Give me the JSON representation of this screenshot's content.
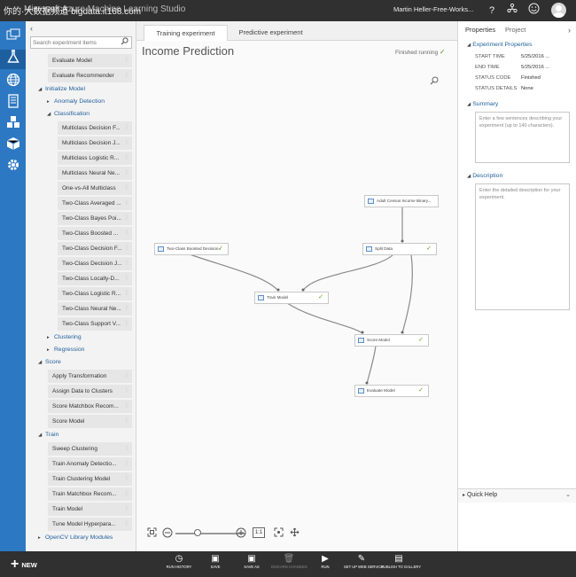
{
  "titlebar": {
    "watermark": "你的·大数据频道 bigdata.it168.com",
    "title": "Microsoft Azure Machine Learning Studio",
    "user": "Martin Heller-Free-Works...",
    "help_glyph": "?"
  },
  "rail": {
    "icons": [
      "projects-icon",
      "experiments-icon",
      "web-services-icon",
      "notebooks-icon",
      "datasets-icon",
      "trained-models-icon",
      "settings-icon"
    ]
  },
  "palette": {
    "collapse_glyph": "‹",
    "search_placeholder": "Search experiment items",
    "items": [
      {
        "kind": "mod",
        "label": "Evaluate Model"
      },
      {
        "kind": "mod",
        "label": "Evaluate Recommender"
      },
      {
        "kind": "cat",
        "label": "Initialize Model",
        "open": true
      },
      {
        "kind": "subcat",
        "label": "Anomaly Detection",
        "open": false
      },
      {
        "kind": "subcat",
        "label": "Classification",
        "open": true
      },
      {
        "kind": "mod2",
        "label": "Multiclass Decision F..."
      },
      {
        "kind": "mod2",
        "label": "Multiclass Decision J..."
      },
      {
        "kind": "mod2",
        "label": "Multiclass Logistic R..."
      },
      {
        "kind": "mod2",
        "label": "Multiclass Neural Ne..."
      },
      {
        "kind": "mod2",
        "label": "One-vs-All Multiclass"
      },
      {
        "kind": "mod2",
        "label": "Two-Class Averaged ..."
      },
      {
        "kind": "mod2",
        "label": "Two-Class Bayes Poi..."
      },
      {
        "kind": "mod2",
        "label": "Two-Class Boosted ..."
      },
      {
        "kind": "mod2",
        "label": "Two-Class Decision F..."
      },
      {
        "kind": "mod2",
        "label": "Two-Class Decision J..."
      },
      {
        "kind": "mod2",
        "label": "Two-Class Locally-D..."
      },
      {
        "kind": "mod2",
        "label": "Two-Class Logistic R..."
      },
      {
        "kind": "mod2",
        "label": "Two-Class Neural Ne..."
      },
      {
        "kind": "mod2",
        "label": "Two-Class Support V..."
      },
      {
        "kind": "subcat",
        "label": "Clustering",
        "open": false
      },
      {
        "kind": "subcat",
        "label": "Regression",
        "open": false
      },
      {
        "kind": "cat",
        "label": "Score",
        "open": true
      },
      {
        "kind": "mod",
        "label": "Apply Transformation"
      },
      {
        "kind": "mod",
        "label": "Assign Data to Clusters"
      },
      {
        "kind": "mod",
        "label": "Score Matchbox Recom..."
      },
      {
        "kind": "mod",
        "label": "Score Model"
      },
      {
        "kind": "cat",
        "label": "Train",
        "open": true
      },
      {
        "kind": "mod",
        "label": "Sweep Clustering"
      },
      {
        "kind": "mod",
        "label": "Train Anomaly Detectio..."
      },
      {
        "kind": "mod",
        "label": "Train Clustering Model"
      },
      {
        "kind": "mod",
        "label": "Train Matchbox Recom..."
      },
      {
        "kind": "mod",
        "label": "Train Model"
      },
      {
        "kind": "mod",
        "label": "Tune Model Hyperpara..."
      },
      {
        "kind": "cat",
        "label": "OpenCV Library Modules",
        "open": false
      }
    ]
  },
  "tabs": [
    {
      "label": "Training experiment",
      "active": true
    },
    {
      "label": "Predictive experiment",
      "active": false
    }
  ],
  "canvas": {
    "title": "Income Prediction",
    "status": "Finished running",
    "status_glyph": "✓",
    "nodes": [
      {
        "label": "Adult Census Income Binary...",
        "check": ""
      },
      {
        "label": "Two-Class Boosted Decision...",
        "check": "✓"
      },
      {
        "label": "Split Data",
        "check": "✓"
      },
      {
        "label": "Train Model",
        "check": "✓"
      },
      {
        "label": "Score Model",
        "check": "✓"
      },
      {
        "label": "Evaluate Model",
        "check": "✓"
      }
    ],
    "zoom": {
      "one_to_one": "1:1",
      "level_fraction": 0.5
    }
  },
  "properties": {
    "tab_properties": "Properties",
    "tab_project": "Project",
    "collapse_glyph": "›",
    "section_experiment": "Experiment Properties",
    "rows": [
      {
        "key": "START TIME",
        "value": "5/25/2016 ..."
      },
      {
        "key": "END TIME",
        "value": "5/25/2016 ..."
      },
      {
        "key": "STATUS CODE",
        "value": "Finished"
      },
      {
        "key": "STATUS DETAILS",
        "value": "None"
      }
    ],
    "section_summary": "Summary",
    "summary_placeholder": "Enter a few sentences describing your experiment (up to 140 characters).",
    "section_description": "Description",
    "description_placeholder": "Enter the detailed description for your experiment.",
    "quick_help": "Quick Help",
    "quick_help_glyph": "⌄"
  },
  "commands": {
    "new_label": "NEW",
    "buttons": [
      {
        "label": "RUN HISTORY",
        "icon": "history-icon",
        "glyph": "◷",
        "enabled": true
      },
      {
        "label": "SAVE",
        "icon": "save-icon",
        "glyph": "▣",
        "enabled": true
      },
      {
        "label": "SAVE AS",
        "icon": "save-as-icon",
        "glyph": "▣",
        "enabled": true
      },
      {
        "label": "DISCARD CHANGES",
        "icon": "trash-icon",
        "glyph": "🗑",
        "enabled": false
      },
      {
        "label": "RUN",
        "icon": "run-icon",
        "glyph": "▶",
        "enabled": true
      },
      {
        "label": "SET UP WEB SERVICE",
        "icon": "web-service-icon",
        "glyph": "✎",
        "enabled": true
      },
      {
        "label": "PUBLISH TO GALLERY",
        "icon": "gallery-icon",
        "glyph": "▤",
        "enabled": true
      }
    ]
  }
}
